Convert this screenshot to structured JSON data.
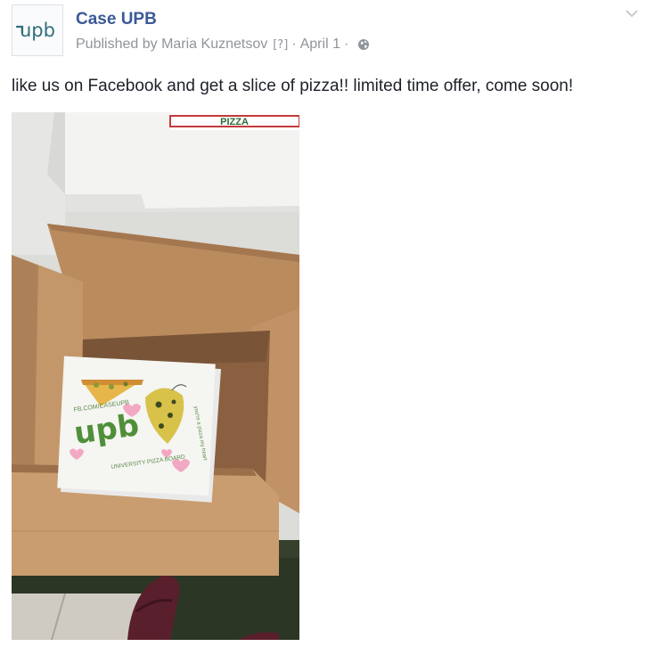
{
  "post": {
    "page_name": "Case UPB",
    "published_by": "Published by Maria Kuznetsov",
    "help_marker": "[?]",
    "separator": "·",
    "date": "April 1",
    "text": "like us on Facebook and get a slice of pizza!! limited time offer, come soon!"
  },
  "avatar": {
    "logo_text": "upb"
  },
  "photo": {
    "box_top_print": "PIZZA",
    "card_url": "FB.COM/CASEUPB",
    "card_logo": "upb",
    "card_footer": "UNIVERSITY PIZZA BOARD",
    "card_side": "you're a pizza my heart"
  },
  "icons": {
    "globe": "globe-icon",
    "chevron": "chevron-down-icon"
  },
  "colors": {
    "link_blue": "#3b5998",
    "meta_gray": "#90949c",
    "text": "#1d2129",
    "logo_green": "#2f7f3e"
  }
}
